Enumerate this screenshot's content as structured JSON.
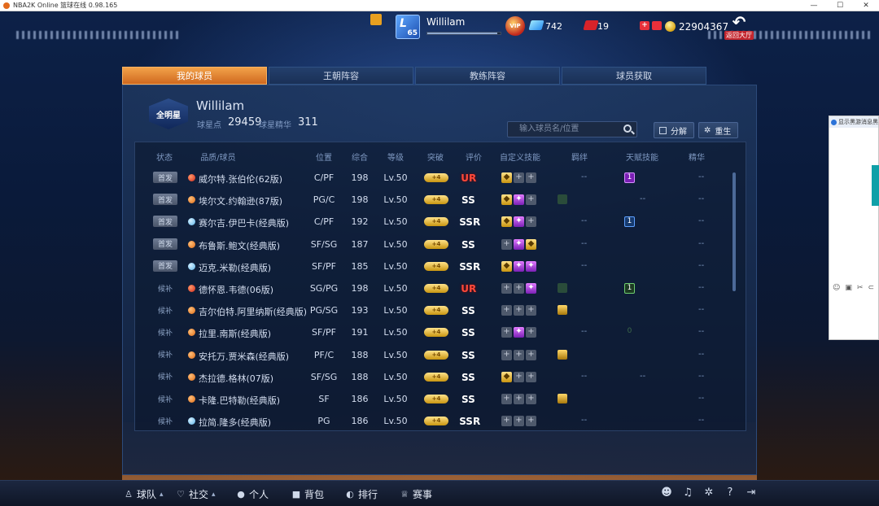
{
  "window": {
    "title": "NBA2K Online 篮球在线 0.98.165",
    "controls": [
      "—",
      "☐",
      "✕"
    ]
  },
  "hud": {
    "player_name": "Willilam",
    "level": "65",
    "xp_fraction": 0.95,
    "vip_label": "VIP",
    "diamonds": "742",
    "tickets": "19",
    "coins": "22904367",
    "back_label": "返回大厅"
  },
  "tabs": [
    {
      "label": "我的球员",
      "active": true
    },
    {
      "label": "王朝阵容",
      "active": false
    },
    {
      "label": "教练阵容",
      "active": false
    },
    {
      "label": "球员获取",
      "active": false
    }
  ],
  "team": {
    "logo_text": "全明星",
    "name": "Willilam",
    "points_label": "球星点",
    "points_value": "29459",
    "essence_label": "球星精华",
    "essence_value": "311"
  },
  "search": {
    "placeholder": "输入球员名/位置"
  },
  "buttons": {
    "decompose": "分解",
    "rebirth": "重生"
  },
  "table": {
    "headers": [
      "状态",
      "品质/球员",
      "位置",
      "综合",
      "等级",
      "突破",
      "评价",
      "自定义技能",
      "羁绊",
      "天赋技能",
      "精华"
    ],
    "rows": [
      {
        "status": "首发",
        "starter": true,
        "dot": "red",
        "name": "威尔特.张伯伦(62版)",
        "pos": "C/PF",
        "ovr": "198",
        "lv": "Lv.50",
        "break": "+4",
        "rating": "UR",
        "skills": [
          "gold",
          "plus",
          "plus"
        ],
        "bond": "--",
        "bond_icon": "",
        "talent": "1",
        "talent_style": "purple",
        "essence": "--"
      },
      {
        "status": "首发",
        "starter": true,
        "dot": "orange",
        "name": "埃尔文.约翰逊(87版)",
        "pos": "PG/C",
        "ovr": "198",
        "lv": "Lv.50",
        "break": "+4",
        "rating": "SS",
        "skills": [
          "gold",
          "purple",
          "plus"
        ],
        "bond": "",
        "bond_icon": "green",
        "talent": "--",
        "talent_style": "text",
        "essence": "--"
      },
      {
        "status": "首发",
        "starter": true,
        "dot": "blue",
        "name": "赛尔吉.伊巴卡(经典版)",
        "pos": "C/PF",
        "ovr": "192",
        "lv": "Lv.50",
        "break": "+4",
        "rating": "SSR",
        "skills": [
          "gold",
          "purple",
          "plus"
        ],
        "bond": "--",
        "bond_icon": "",
        "talent": "1",
        "talent_style": "blue",
        "essence": "--"
      },
      {
        "status": "首发",
        "starter": true,
        "dot": "orange",
        "name": "布鲁斯.鲍文(经典版)",
        "pos": "SF/SG",
        "ovr": "187",
        "lv": "Lv.50",
        "break": "+4",
        "rating": "SS",
        "skills": [
          "plus",
          "purple",
          "gold"
        ],
        "bond": "--",
        "bond_icon": "",
        "talent": "",
        "talent_style": "",
        "essence": "--"
      },
      {
        "status": "首发",
        "starter": true,
        "dot": "blue",
        "name": "迈克.米勒(经典版)",
        "pos": "SF/PF",
        "ovr": "185",
        "lv": "Lv.50",
        "break": "+4",
        "rating": "SSR",
        "skills": [
          "gold",
          "purple",
          "purple"
        ],
        "bond": "--",
        "bond_icon": "",
        "talent": "",
        "talent_style": "",
        "essence": "--"
      },
      {
        "status": "候补",
        "starter": false,
        "dot": "red",
        "name": "德怀恩.韦德(06版)",
        "pos": "SG/PG",
        "ovr": "198",
        "lv": "Lv.50",
        "break": "+4",
        "rating": "UR",
        "skills": [
          "plus",
          "plus",
          "purple"
        ],
        "bond": "",
        "bond_icon": "green",
        "talent": "1",
        "talent_style": "green",
        "essence": "--"
      },
      {
        "status": "候补",
        "starter": false,
        "dot": "orange",
        "name": "吉尔伯特.阿里纳斯(经典版)",
        "pos": "PG/SG",
        "ovr": "193",
        "lv": "Lv.50",
        "break": "+4",
        "rating": "SS",
        "skills": [
          "plus",
          "plus",
          "plus"
        ],
        "bond": "",
        "bond_icon": "gold",
        "talent": "",
        "talent_style": "",
        "essence": "--"
      },
      {
        "status": "候补",
        "starter": false,
        "dot": "orange",
        "name": "拉里.南斯(经典版)",
        "pos": "SF/PF",
        "ovr": "191",
        "lv": "Lv.50",
        "break": "+4",
        "rating": "SS",
        "skills": [
          "plus",
          "purple",
          "plus"
        ],
        "bond": "--",
        "bond_icon": "",
        "talent": "0",
        "talent_style": "dim",
        "essence": "--"
      },
      {
        "status": "候补",
        "starter": false,
        "dot": "orange",
        "name": "安托万.贾米森(经典版)",
        "pos": "PF/C",
        "ovr": "188",
        "lv": "Lv.50",
        "break": "+4",
        "rating": "SS",
        "skills": [
          "plus",
          "plus",
          "plus"
        ],
        "bond": "",
        "bond_icon": "gold",
        "talent": "",
        "talent_style": "",
        "essence": "--"
      },
      {
        "status": "候补",
        "starter": false,
        "dot": "orange",
        "name": "杰拉德.格林(07版)",
        "pos": "SF/SG",
        "ovr": "188",
        "lv": "Lv.50",
        "break": "+4",
        "rating": "SS",
        "skills": [
          "gold",
          "plus",
          "plus"
        ],
        "bond": "--",
        "bond_icon": "",
        "talent": "--",
        "talent_style": "text",
        "essence": "--"
      },
      {
        "status": "候补",
        "starter": false,
        "dot": "orange",
        "name": "卡隆.巴特勒(经典版)",
        "pos": "SF",
        "ovr": "186",
        "lv": "Lv.50",
        "break": "+4",
        "rating": "SS",
        "skills": [
          "plus",
          "plus",
          "plus"
        ],
        "bond": "",
        "bond_icon": "gold",
        "talent": "",
        "talent_style": "",
        "essence": "--"
      },
      {
        "status": "候补",
        "starter": false,
        "dot": "blue",
        "name": "拉简.隆多(经典版)",
        "pos": "PG",
        "ovr": "186",
        "lv": "Lv.50",
        "break": "+4",
        "rating": "SSR",
        "skills": [
          "plus",
          "plus",
          "plus"
        ],
        "bond": "--",
        "bond_icon": "",
        "talent": "",
        "talent_style": "",
        "essence": "--"
      }
    ]
  },
  "side_popup": {
    "text": "显示黑游消息黑游"
  },
  "bottom_nav": [
    {
      "label": "球队",
      "icon": "user-icon",
      "glyph": "♙",
      "caret": true
    },
    {
      "label": "社交",
      "icon": "heart-icon",
      "glyph": "♡",
      "caret": true
    },
    {
      "label": "个人",
      "icon": "person-icon",
      "glyph": "●",
      "caret": false
    },
    {
      "label": "背包",
      "icon": "bag-icon",
      "glyph": "■",
      "caret": false
    },
    {
      "label": "排行",
      "icon": "rank-icon",
      "glyph": "◐",
      "caret": false
    },
    {
      "label": "赛事",
      "icon": "trophy-icon",
      "glyph": "♕",
      "caret": false
    }
  ],
  "bottom_tools": [
    {
      "icon": "chat-icon",
      "glyph": "☻"
    },
    {
      "icon": "music-icon",
      "glyph": "♫"
    },
    {
      "icon": "settings-icon",
      "glyph": "✲"
    },
    {
      "icon": "help-icon",
      "glyph": "?"
    },
    {
      "icon": "exit-icon",
      "glyph": "⇥"
    }
  ],
  "colors": {
    "accent_tab": "#e07a2a",
    "ur": "#ff4a3a",
    "gold": "#d9a516"
  }
}
